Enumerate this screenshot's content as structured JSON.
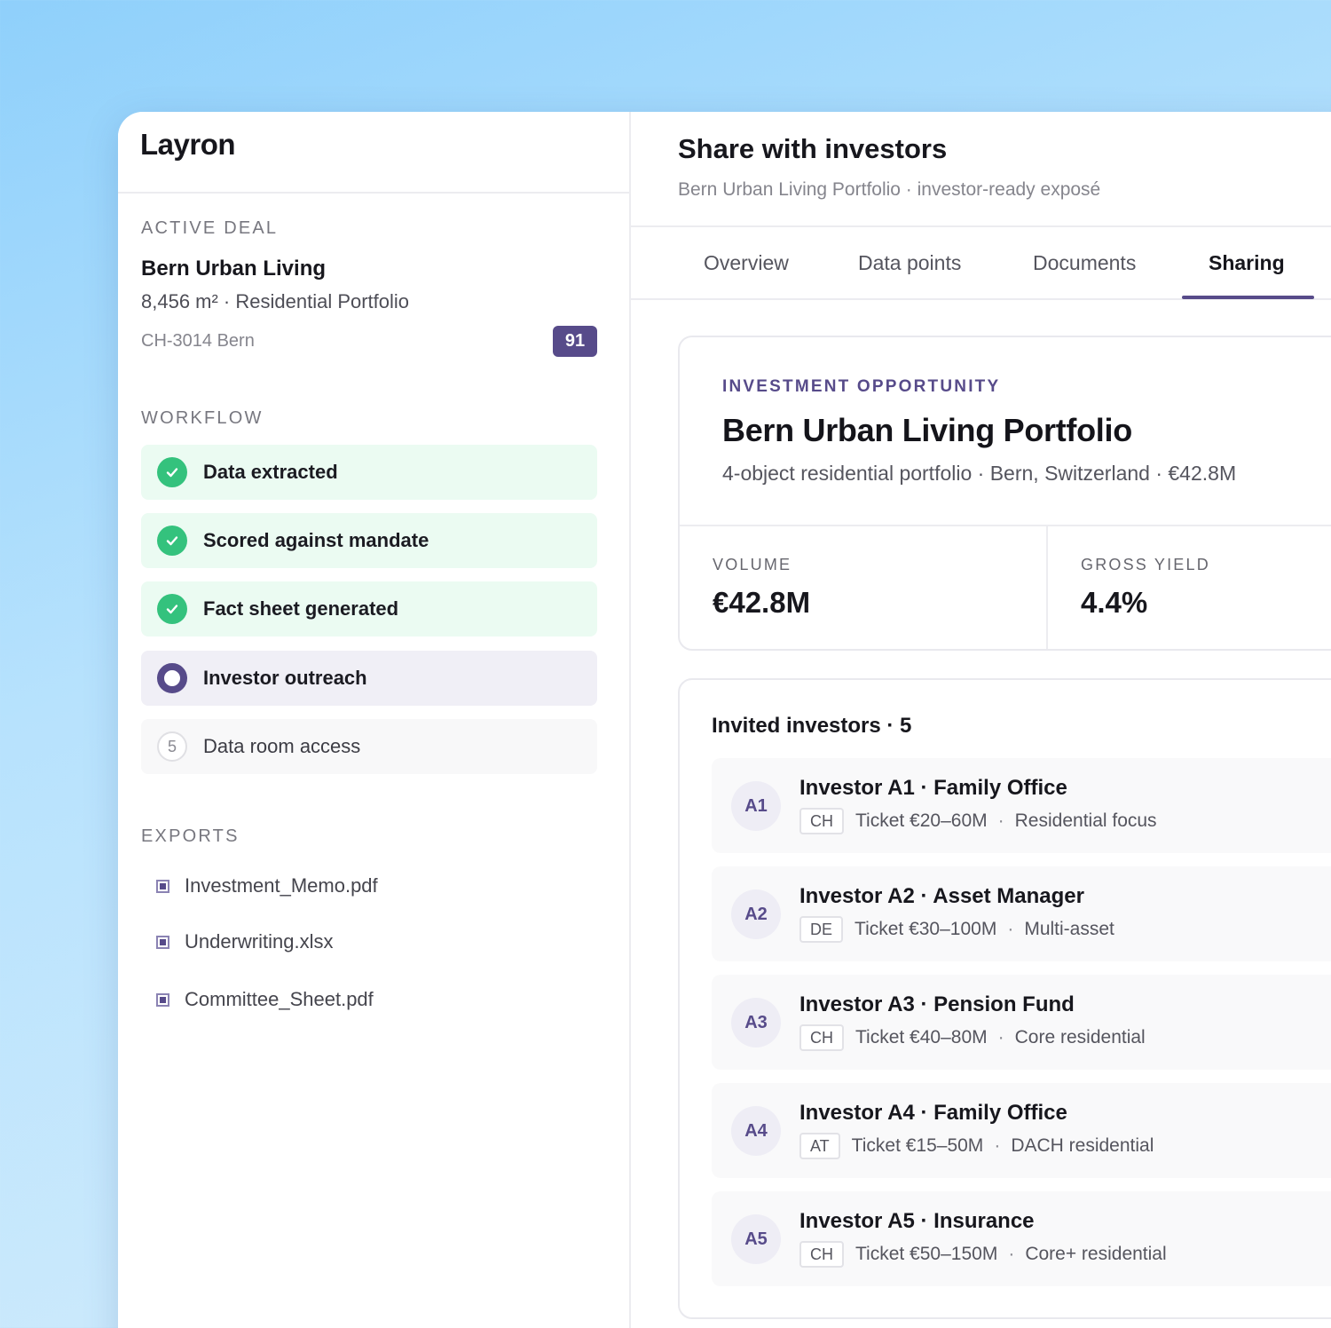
{
  "app": {
    "logo": "Layron"
  },
  "sidebar": {
    "active_deal_label": "ACTIVE DEAL",
    "deal_name": "Bern Urban Living",
    "deal_sub": "8,456 m² · Residential Portfolio",
    "deal_location": "CH-3014 Bern",
    "score": "91",
    "workflow_label": "WORKFLOW",
    "steps": [
      {
        "label": "Data extracted",
        "status": "done"
      },
      {
        "label": "Scored against mandate",
        "status": "done"
      },
      {
        "label": "Fact sheet generated",
        "status": "done"
      },
      {
        "label": "Investor outreach",
        "status": "active"
      },
      {
        "label": "Data room access",
        "status": "pending",
        "number": "5"
      }
    ],
    "exports_label": "EXPORTS",
    "exports": [
      {
        "label": "Investment_Memo.pdf"
      },
      {
        "label": "Underwriting.xlsx"
      },
      {
        "label": "Committee_Sheet.pdf"
      }
    ]
  },
  "main": {
    "title": "Share with investors",
    "subtitle": "Bern Urban Living Portfolio · investor-ready exposé",
    "tabs": [
      {
        "label": "Overview"
      },
      {
        "label": "Data points"
      },
      {
        "label": "Documents"
      },
      {
        "label": "Sharing",
        "active": true
      }
    ],
    "opportunity": {
      "eyebrow": "INVESTMENT OPPORTUNITY",
      "title": "Bern Urban Living Portfolio",
      "subtitle": "4-object residential portfolio · Bern, Switzerland · €42.8M",
      "metrics": [
        {
          "label": "VOLUME",
          "value": "€42.8M"
        },
        {
          "label": "GROSS YIELD",
          "value": "4.4%"
        }
      ]
    },
    "investors": {
      "heading": "Invited investors · 5",
      "separator": "·",
      "items": [
        {
          "initials": "A1",
          "name": "Investor A1 · Family Office",
          "country": "CH",
          "ticket": "Ticket €20–60M",
          "focus": "Residential focus"
        },
        {
          "initials": "A2",
          "name": "Investor A2 · Asset Manager",
          "country": "DE",
          "ticket": "Ticket €30–100M",
          "focus": "Multi-asset"
        },
        {
          "initials": "A3",
          "name": "Investor A3 · Pension Fund",
          "country": "CH",
          "ticket": "Ticket €40–80M",
          "focus": "Core residential"
        },
        {
          "initials": "A4",
          "name": "Investor A4 · Family Office",
          "country": "AT",
          "ticket": "Ticket €15–50M",
          "focus": "DACH residential"
        },
        {
          "initials": "A5",
          "name": "Investor A5 · Insurance",
          "country": "CH",
          "ticket": "Ticket €50–150M",
          "focus": "Core+ residential"
        }
      ]
    }
  },
  "colors": {
    "accent": "#574b8a",
    "success": "#34c27d"
  }
}
